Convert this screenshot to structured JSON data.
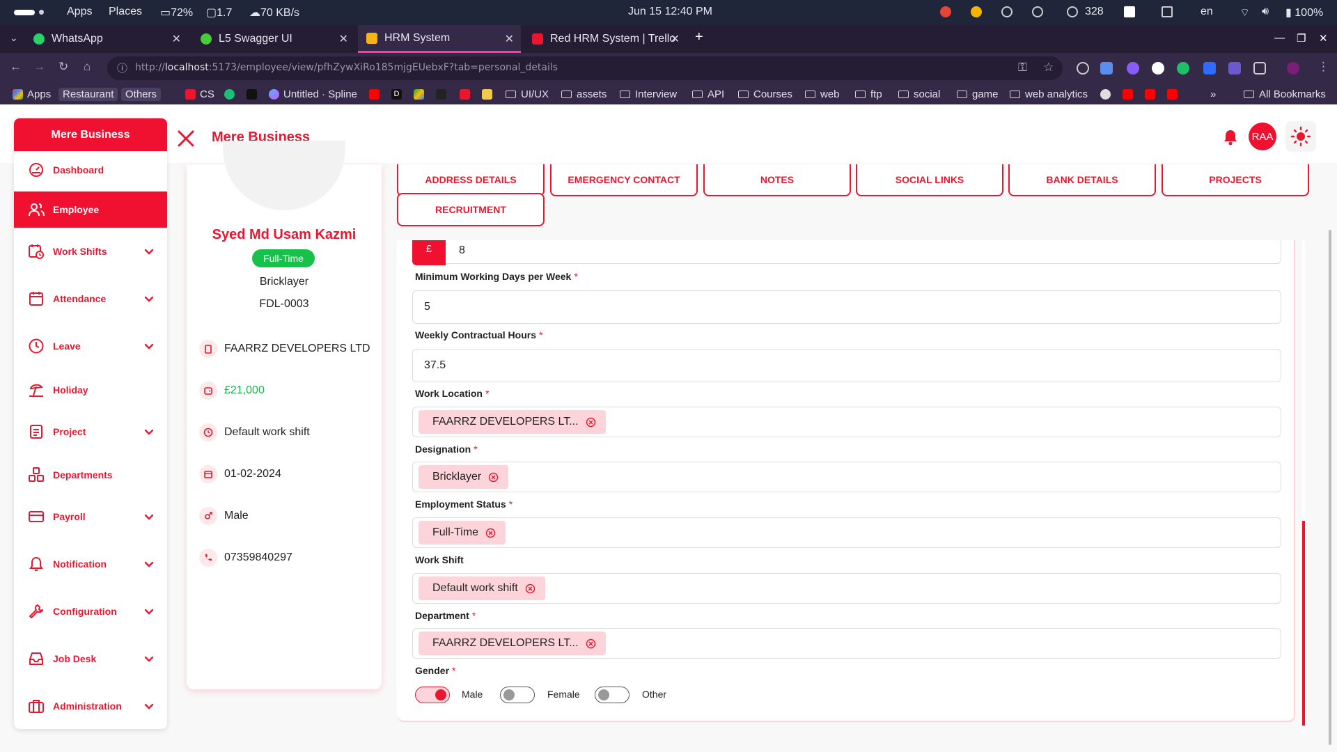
{
  "os": {
    "apps": "Apps",
    "places": "Places",
    "battery_stat": "72%",
    "cpu_stat": "1.7",
    "net_stat": "70 KB/s",
    "datetime": "Jun 15  12:40 PM",
    "count": "328",
    "lang": "en",
    "battery": "100%"
  },
  "tabs": [
    {
      "label": "WhatsApp",
      "color": "#25d366"
    },
    {
      "label": "L5 Swagger UI",
      "color": "#49cc3a"
    },
    {
      "label": "HRM System",
      "color": "#f5b416"
    },
    {
      "label": "Red HRM System | Trello",
      "color": "#e8172f"
    }
  ],
  "browser": {
    "url_host": "localhost",
    "url_prefix": "http://",
    "url_rest": ":5173/employee/view/pfhZywXiRo185mjgEUebxF?tab=personal_details"
  },
  "bookmarks": {
    "apps": "Apps",
    "chip1": "Restaurant",
    "chip2": "Others",
    "cs": "CS",
    "spline": "Untitled · Spline",
    "d": "D",
    "folders": [
      "UI/UX",
      "assets",
      "Interview",
      "API",
      "Courses",
      "web",
      "ftp",
      "social",
      "game",
      "web analytics"
    ],
    "more": "»",
    "all": "All Bookmarks"
  },
  "app": {
    "brand": "Mere Business",
    "header_title": "Mere Business",
    "user_initials": "RAA"
  },
  "sidebar": [
    {
      "label": "Dashboard",
      "icon": "dashboard-icon",
      "chev": false
    },
    {
      "label": "Employee",
      "icon": "users-icon",
      "chev": false
    },
    {
      "label": "Work Shifts",
      "icon": "calendar-clock-icon",
      "chev": true
    },
    {
      "label": "Attendance",
      "icon": "calendar-icon",
      "chev": true
    },
    {
      "label": "Leave",
      "icon": "clock-icon",
      "chev": true
    },
    {
      "label": "Holiday",
      "icon": "beach-icon",
      "chev": false
    },
    {
      "label": "Project",
      "icon": "clipboard-icon",
      "chev": true
    },
    {
      "label": "Departments",
      "icon": "cubes-icon",
      "chev": false
    },
    {
      "label": "Payroll",
      "icon": "card-icon",
      "chev": true
    },
    {
      "label": "Notification",
      "icon": "bell-icon",
      "chev": true
    },
    {
      "label": "Configuration",
      "icon": "wrench-icon",
      "chev": true
    },
    {
      "label": "Job Desk",
      "icon": "inbox-icon",
      "chev": true
    },
    {
      "label": "Administration",
      "icon": "briefcase-icon",
      "chev": true
    }
  ],
  "profile": {
    "name": "Syed Md Usam Kazmi",
    "status": "Full-Time",
    "designation": "Bricklayer",
    "code": "FDL-0003",
    "company": "FAARRZ DEVELOPERS LTD",
    "salary": "£21,000",
    "shift": "Default work shift",
    "date": "01-02-2024",
    "gender": "Male",
    "phone": "07359840297"
  },
  "detail_tabs": [
    "ADDRESS DETAILS",
    "EMERGENCY CONTACT",
    "NOTES",
    "SOCIAL LINKS",
    "BANK DETAILS",
    "PROJECTS",
    "RECRUITMENT"
  ],
  "form": {
    "currency_symbol": "£",
    "partial_value": "8",
    "min_days_label": "Minimum Working Days per Week",
    "min_days": "5",
    "weekly_hours_label": "Weekly Contractual Hours",
    "weekly_hours": "37.5",
    "work_location_label": "Work Location",
    "work_location": "FAARRZ DEVELOPERS LT...",
    "designation_label": "Designation",
    "designation": "Bricklayer",
    "emp_status_label": "Employment Status",
    "emp_status": "Full-Time",
    "work_shift_label": "Work Shift",
    "work_shift": "Default work shift",
    "department_label": "Department",
    "department": "FAARRZ DEVELOPERS LT...",
    "gender_label": "Gender",
    "required_mark": "*",
    "gender_options": [
      {
        "label": "Male",
        "selected": true
      },
      {
        "label": "Female",
        "selected": false
      },
      {
        "label": "Other",
        "selected": false
      }
    ]
  },
  "colors": {
    "accent": "#f0102f",
    "success": "#17c24a",
    "tag_bg": "#fdd4d9"
  }
}
